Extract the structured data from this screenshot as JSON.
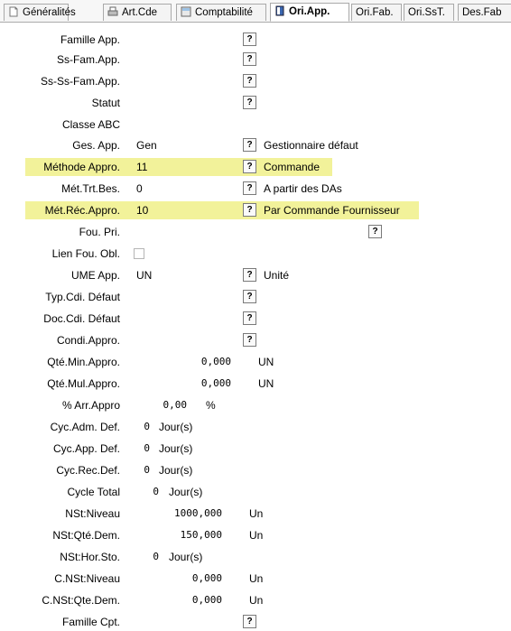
{
  "tabs": [
    {
      "label": "Généralités",
      "icon": "document-icon"
    },
    {
      "label": "Art.Cde",
      "icon": "printer-icon"
    },
    {
      "label": "Comptabilité",
      "icon": "calculator-icon"
    },
    {
      "label": "Ori.App.",
      "icon": "book-icon",
      "active": true
    },
    {
      "label": "Ori.Fab."
    },
    {
      "label": "Ori.SsT."
    },
    {
      "label": "Des.Fab"
    }
  ],
  "fields": [
    {
      "label": "Famille App.",
      "help": "?"
    },
    {
      "label": "Ss-Fam.App.",
      "help": "?"
    },
    {
      "label": "Ss-Ss-Fam.App.",
      "help": "?"
    },
    {
      "label": "Statut",
      "help": "?"
    },
    {
      "label": "Classe ABC"
    },
    {
      "label": "Ges. App.",
      "value": "Gen",
      "help": "?",
      "desc": "Gestionnaire défaut"
    },
    {
      "label": "Méthode Appro.",
      "value": "11",
      "help": "?",
      "desc": "Commande",
      "highlight": true
    },
    {
      "label": "Mét.Trt.Bes.",
      "value": "0",
      "help": "?",
      "desc": "A partir des DAs"
    },
    {
      "label": "Mét.Réc.Appro.",
      "value": "10",
      "help": "?",
      "desc": "Par Commande Fournisseur",
      "highlight": true
    },
    {
      "label": "Fou. Pri.",
      "help": "?"
    },
    {
      "label": "Lien Fou. Obl.",
      "checked": false
    },
    {
      "label": "UME App.",
      "value": "UN",
      "help": "?",
      "desc": "Unité"
    },
    {
      "label": "Typ.Cdi. Défaut",
      "help": "?"
    },
    {
      "label": "Doc.Cdi. Défaut",
      "help": "?"
    },
    {
      "label": "Condi.Appro.",
      "help": "?"
    },
    {
      "label": "Qté.Min.Appro.",
      "number": "0,000",
      "unit": "UN"
    },
    {
      "label": "Qté.Mul.Appro.",
      "number": "0,000",
      "unit": "UN"
    },
    {
      "label": "% Arr.Appro",
      "number": "0,00",
      "unit": "%"
    },
    {
      "label": "Cyc.Adm. Def.",
      "number": "0",
      "unit": "Jour(s)"
    },
    {
      "label": "Cyc.App. Def.",
      "number": "0",
      "unit": "Jour(s)"
    },
    {
      "label": "Cyc.Rec.Def.",
      "number": "0",
      "unit": "Jour(s)"
    },
    {
      "label": "Cycle Total",
      "number": "0",
      "unit": "Jour(s)"
    },
    {
      "label": "NSt:Niveau",
      "number": "1000,000",
      "unit": "Un"
    },
    {
      "label": "NSt:Qté.Dem.",
      "number": "150,000",
      "unit": "Un"
    },
    {
      "label": "NSt:Hor.Sto.",
      "number": "0",
      "unit": "Jour(s)"
    },
    {
      "label": "C.NSt:Niveau",
      "number": "0,000",
      "unit": "Un"
    },
    {
      "label": "C.NSt:Qte.Dem.",
      "number": "0,000",
      "unit": "Un"
    },
    {
      "label": "Famille Cpt.",
      "help": "?"
    }
  ],
  "colors": {
    "highlight": "#f2f29a"
  }
}
